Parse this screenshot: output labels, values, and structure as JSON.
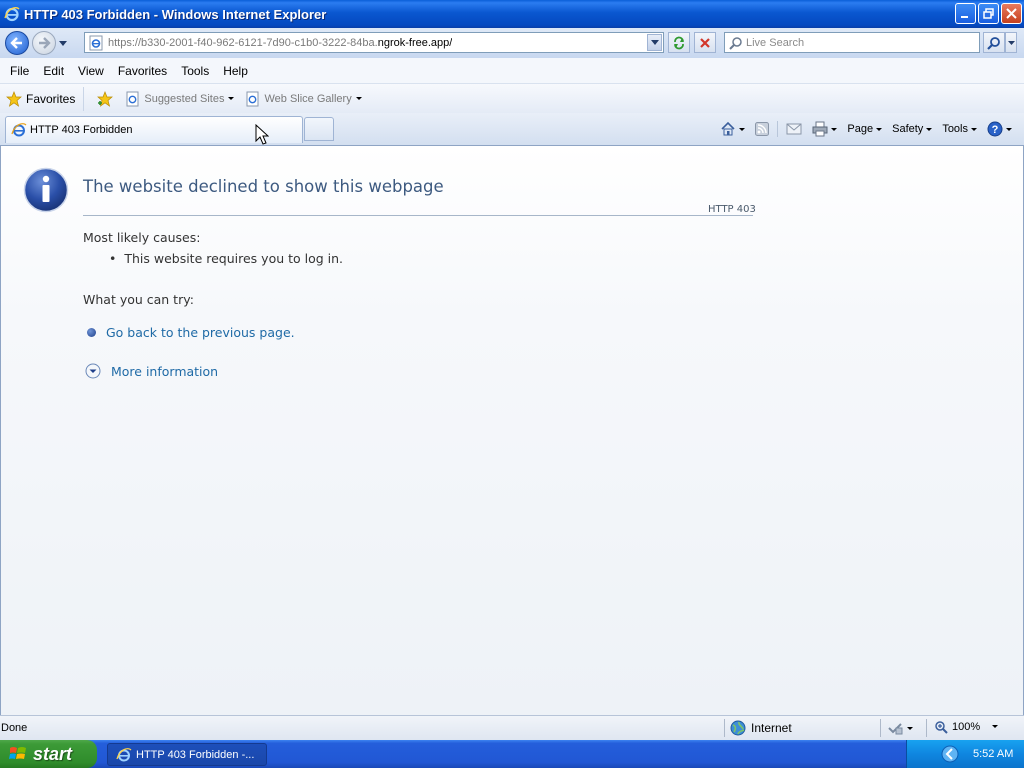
{
  "window": {
    "title": "HTTP 403 Forbidden - Windows Internet Explorer"
  },
  "address_bar": {
    "url_prefix": "https://b330-2001-f40-962-6121-7d90-c1b0-3222-84ba.",
    "url_host": "ngrok-free.app/",
    "search_placeholder": "Live Search"
  },
  "menu": {
    "items": [
      "File",
      "Edit",
      "View",
      "Favorites",
      "Tools",
      "Help"
    ]
  },
  "favorites_bar": {
    "favorites_label": "Favorites",
    "links": [
      "Suggested Sites",
      "Web Slice Gallery"
    ]
  },
  "tabs": {
    "active_label": "HTTP 403 Forbidden"
  },
  "command_bar": {
    "page_label": "Page",
    "safety_label": "Safety",
    "tools_label": "Tools"
  },
  "error_page": {
    "title": "The website declined to show this webpage",
    "code": "HTTP 403",
    "causes_heading": "Most likely causes:",
    "causes": [
      "This website requires you to log in."
    ],
    "try_heading": "What you can try:",
    "back_link": "Go back to the previous page.",
    "more_info_link": "More information"
  },
  "status_bar": {
    "status": "Done",
    "zone": "Internet",
    "zoom": "100%"
  },
  "taskbar": {
    "start_label": "start",
    "item_label": "HTTP 403 Forbidden -...",
    "clock": "5:52 AM"
  },
  "colors": {
    "title_text": "#3d5a80",
    "link": "#1f6aa6",
    "titlebar": "#0a57d0",
    "taskbar": "#245edb",
    "start_button": "#3c9a37"
  }
}
